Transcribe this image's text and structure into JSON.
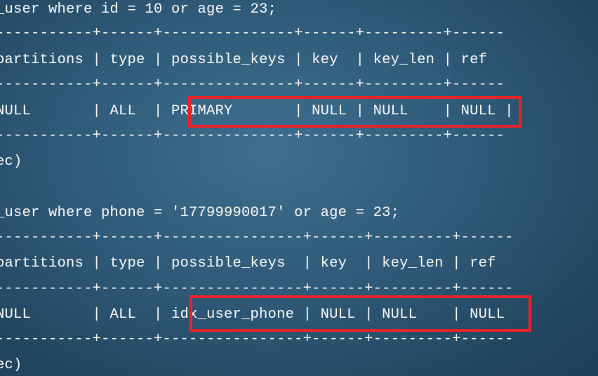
{
  "terminal": {
    "lines": [
      "_user where id = 10 or age = 23;",
      "-----------+------+---------------+------+---------+------",
      "partitions | type | possible_keys | key  | key_len | ref  ",
      "-----------+------+---------------+------+---------+------",
      "NULL       | ALL  | PRIMARY       | NULL | NULL    | NULL |",
      "-----------+------+---------------+------+---------+------",
      "ec)",
      "_user where phone = '17799990017' or age = 23;",
      "-----------+------+----------------+------+---------+------",
      "partitions | type | possible_keys  | key  | key_len | ref  ",
      "-----------+------+----------------+------+---------+------",
      "NULL       | ALL  | idx_user_phone | NULL | NULL    | NULL",
      "-----------+------+----------------+------+---------+------",
      "ec)"
    ]
  },
  "highlight_color": "#e8232a"
}
